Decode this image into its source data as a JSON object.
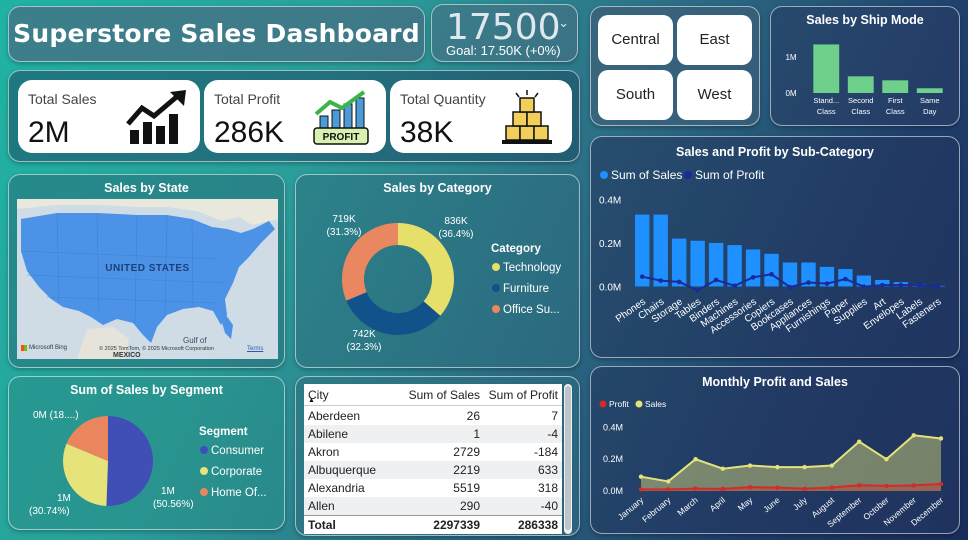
{
  "title": "Superstore Sales Dashboard",
  "goal": {
    "value": "17500",
    "text": "Goal: 17.50K (+0%)"
  },
  "cards": [
    {
      "label": "Total Sales",
      "value": "2M",
      "icon": "trend-up-chart-icon"
    },
    {
      "label": "Total Profit",
      "value": "286K",
      "icon": "profit-chart-icon",
      "icon_text": "PROFIT"
    },
    {
      "label": "Total Quantity",
      "value": "38K",
      "icon": "boxes-stack-icon"
    }
  ],
  "regions": [
    "Central",
    "East",
    "South",
    "West"
  ],
  "ship_mode": {
    "title": "Sales by Ship Mode",
    "y_ticks": [
      "1M",
      "0M"
    ],
    "chart_data": {
      "type": "bar",
      "categories": [
        "Stand... Class",
        "Second Class",
        "First Class",
        "Same Day"
      ],
      "categories_lines": [
        [
          "Stand...",
          "Class"
        ],
        [
          "Second",
          "Class"
        ],
        [
          "First",
          "Class"
        ],
        [
          "Same",
          "Day"
        ]
      ],
      "values": [
        1.34,
        0.46,
        0.35,
        0.13
      ],
      "ylim": [
        0,
        1.6
      ],
      "color": "#6fd08c"
    }
  },
  "subcat": {
    "title": "Sales and Profit by Sub-Category",
    "legend": [
      "Sum of Sales",
      "Sum of Profit"
    ],
    "y_ticks": [
      "0.4M",
      "0.2M",
      "0.0M"
    ],
    "chart_data": {
      "type": "bar",
      "categories": [
        "Phones",
        "Chairs",
        "Storage",
        "Tables",
        "Binders",
        "Machines",
        "Accessories",
        "Copiers",
        "Bookcases",
        "Appliances",
        "Furnishings",
        "Paper",
        "Supplies",
        "Art",
        "Envelopes",
        "Labels",
        "Fasteners"
      ],
      "series": [
        {
          "name": "Sum of Sales",
          "values": [
            0.33,
            0.33,
            0.22,
            0.21,
            0.2,
            0.19,
            0.17,
            0.15,
            0.11,
            0.11,
            0.09,
            0.08,
            0.05,
            0.03,
            0.02,
            0.01,
            0.003
          ],
          "color": "#1e90ff"
        },
        {
          "name": "Sum of Profit",
          "values": [
            0.045,
            0.027,
            0.021,
            -0.018,
            0.03,
            0.003,
            0.042,
            0.056,
            -0.003,
            0.018,
            0.013,
            0.034,
            -0.001,
            0.006,
            0.007,
            0.006,
            0.001
          ],
          "color": "#1a2a9a"
        }
      ],
      "ylim": [
        -0.03,
        0.42
      ]
    }
  },
  "monthly": {
    "title": "Monthly Profit and Sales",
    "legend": [
      "Profit",
      "Sales"
    ],
    "y_ticks": [
      "0.4M",
      "0.2M",
      "0.0M"
    ],
    "chart_data": {
      "type": "area",
      "categories": [
        "January",
        "February",
        "March",
        "April",
        "May",
        "June",
        "July",
        "August",
        "September",
        "October",
        "November",
        "December"
      ],
      "series": [
        {
          "name": "Profit",
          "values": [
            0.01,
            0.01,
            0.015,
            0.013,
            0.024,
            0.021,
            0.014,
            0.022,
            0.036,
            0.032,
            0.035,
            0.044
          ],
          "color": "#d42a2a"
        },
        {
          "name": "Sales",
          "values": [
            0.09,
            0.06,
            0.2,
            0.14,
            0.16,
            0.15,
            0.15,
            0.16,
            0.31,
            0.2,
            0.35,
            0.33
          ],
          "color": "#e4e27a"
        }
      ],
      "ylim": [
        0,
        0.44
      ]
    }
  },
  "state": {
    "title": "Sales by State",
    "map_label": "UNITED STATES",
    "gulf_label": "Gulf of",
    "mexico_label": "MEXICO",
    "logo_text": "Microsoft Bing",
    "copyright": "© 2025 TomTom, © 2025 Microsoft Corporation",
    "terms": "Terms"
  },
  "category": {
    "title": "Sales by Category",
    "legend_title": "Category",
    "chart_data": {
      "type": "pie",
      "categories": [
        "Technology",
        "Furniture",
        "Office Su..."
      ],
      "values": [
        836,
        742,
        719
      ],
      "colors": [
        "#e6df6a",
        "#12528a",
        "#e98860"
      ]
    },
    "labels": [
      {
        "value": "836K",
        "pct": "(36.4%)"
      },
      {
        "value": "742K",
        "pct": "(32.3%)"
      },
      {
        "value": "719K",
        "pct": "(31.3%)"
      }
    ]
  },
  "segment": {
    "title": "Sum of Sales by Segment",
    "legend_title": "Segment",
    "chart_data": {
      "type": "pie",
      "categories": [
        "Consumer",
        "Corporate",
        "Home Of..."
      ],
      "values": [
        50.56,
        30.74,
        18.7
      ],
      "colors": [
        "#3f4fb6",
        "#e6e37a",
        "#e9865e"
      ]
    },
    "labels": [
      {
        "value": "1M",
        "pct": "(50.56%)"
      },
      {
        "value": "1M",
        "pct": "(30.74%)"
      },
      {
        "value": "0M (18....)",
        "pct": ""
      }
    ]
  },
  "table": {
    "headers": [
      "City",
      "Sum of Sales",
      "Sum of Profit"
    ],
    "rows": [
      [
        "Aberdeen",
        "26",
        "7"
      ],
      [
        "Abilene",
        "1",
        "-4"
      ],
      [
        "Akron",
        "2729",
        "-184"
      ],
      [
        "Albuquerque",
        "2219",
        "633"
      ],
      [
        "Alexandria",
        "5519",
        "318"
      ],
      [
        "Allen",
        "290",
        "-40"
      ]
    ],
    "total": [
      "Total",
      "2297339",
      "286338"
    ]
  }
}
